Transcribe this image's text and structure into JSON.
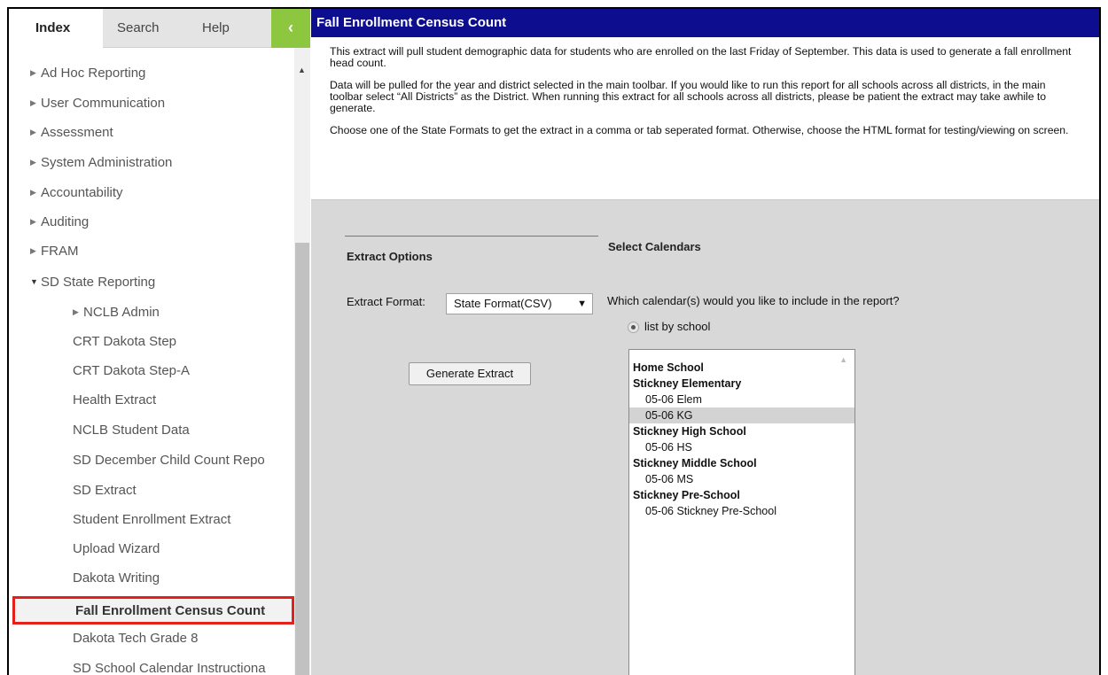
{
  "tabs": {
    "index": "Index",
    "search": "Search",
    "help": "Help",
    "collapse": "‹"
  },
  "tree": [
    {
      "label": "Ad Hoc Reporting",
      "tri": "▶"
    },
    {
      "label": "User Communication",
      "tri": "▶"
    },
    {
      "label": "Assessment",
      "tri": "▶"
    },
    {
      "label": "System Administration",
      "tri": "▶"
    },
    {
      "label": "Accountability",
      "tri": "▶"
    },
    {
      "label": "Auditing",
      "tri": "▶"
    },
    {
      "label": "FRAM",
      "tri": "▶"
    },
    {
      "label": "SD State Reporting",
      "tri": "▼"
    },
    {
      "label": "NCLB Admin",
      "tri": "▶"
    },
    {
      "label": "CRT Dakota Step"
    },
    {
      "label": "CRT Dakota Step-A"
    },
    {
      "label": "Health Extract"
    },
    {
      "label": "NCLB Student Data"
    },
    {
      "label": "SD December Child Count Repo"
    },
    {
      "label": "SD Extract"
    },
    {
      "label": "Student Enrollment Extract"
    },
    {
      "label": "Upload Wizard"
    },
    {
      "label": "Dakota Writing"
    },
    {
      "label": "Fall Enrollment Census Count"
    },
    {
      "label": "Dakota Tech Grade 8"
    },
    {
      "label": "SD School Calendar Instructiona"
    }
  ],
  "scroll": {
    "up": "▲"
  },
  "main": {
    "title": "Fall Enrollment Census Count",
    "desc": [
      "This extract will pull student demographic data for students who are enrolled on the last Friday of September. This data is used to generate a fall enrollment head count.",
      "Data will be pulled for the year and district selected in the main toolbar. If you would like to run this report for all schools across all districts, in the main toolbar select “All Districts” as the District. When running this extract for all schools across all districts, please be patient the extract may take awhile to generate.",
      "Choose one of the State Formats to get the extract in a comma or tab seperated format. Otherwise, choose the HTML format for testing/viewing on screen."
    ],
    "extract_options": "Extract Options",
    "format_label": "Extract Format:",
    "format_value": "State Format(CSV)",
    "format_arrow": "▼",
    "generate_btn": "Generate Extract",
    "calendars_head": "Select Calendars",
    "calendars_question": "Which calendar(s) would you like to include in the report?",
    "radio_label": "list by school",
    "calendar_list_scroll": "▲",
    "calendars": [
      {
        "label": "Home School",
        "kind": "grp"
      },
      {
        "label": "Stickney Elementary",
        "kind": "grp"
      },
      {
        "label": "05-06 Elem",
        "kind": "opt"
      },
      {
        "label": "05-06 KG",
        "kind": "opt",
        "selected": true
      },
      {
        "label": "Stickney High School",
        "kind": "grp"
      },
      {
        "label": "05-06 HS",
        "kind": "opt"
      },
      {
        "label": "Stickney Middle School",
        "kind": "grp"
      },
      {
        "label": "05-06 MS",
        "kind": "opt"
      },
      {
        "label": "Stickney Pre-School",
        "kind": "grp"
      },
      {
        "label": "05-06 Stickney Pre-School",
        "kind": "opt"
      }
    ]
  }
}
